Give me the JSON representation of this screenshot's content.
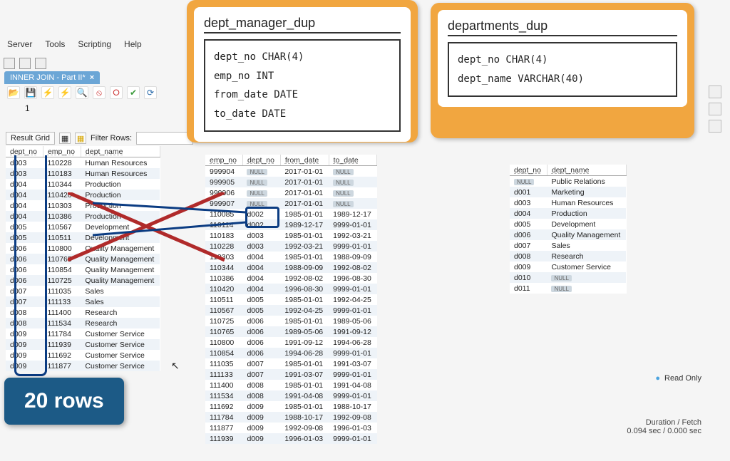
{
  "menu": {
    "server": "Server",
    "tools": "Tools",
    "scripting": "Scripting",
    "help": "Help"
  },
  "tab": {
    "label": "INNER JOIN - Part II*",
    "close": "×"
  },
  "row_indicator": "1",
  "result_bar": {
    "grid": "Result Grid",
    "filter": "Filter Rows:",
    "placeholder": ""
  },
  "card_left": {
    "title": "dept_manager_dup",
    "lines": [
      "dept_no CHAR(4)",
      "emp_no INT",
      "from_date DATE",
      "to_date DATE"
    ]
  },
  "card_right": {
    "title": "departments_dup",
    "lines": [
      "dept_no CHAR(4)",
      "dept_name VARCHAR(40)"
    ]
  },
  "join_table": {
    "headers": [
      "dept_no",
      "emp_no",
      "dept_name"
    ],
    "rows": [
      [
        "d003",
        "110228",
        "Human Resources"
      ],
      [
        "d003",
        "110183",
        "Human Resources"
      ],
      [
        "d004",
        "110344",
        "Production"
      ],
      [
        "d004",
        "110420",
        "Production"
      ],
      [
        "d004",
        "110303",
        "Production"
      ],
      [
        "d004",
        "110386",
        "Production"
      ],
      [
        "d005",
        "110567",
        "Development"
      ],
      [
        "d005",
        "110511",
        "Development"
      ],
      [
        "d006",
        "110800",
        "Quality Management"
      ],
      [
        "d006",
        "110765",
        "Quality Management"
      ],
      [
        "d006",
        "110854",
        "Quality Management"
      ],
      [
        "d006",
        "110725",
        "Quality Management"
      ],
      [
        "d007",
        "111035",
        "Sales"
      ],
      [
        "d007",
        "111133",
        "Sales"
      ],
      [
        "d008",
        "111400",
        "Research"
      ],
      [
        "d008",
        "111534",
        "Research"
      ],
      [
        "d009",
        "111784",
        "Customer Service"
      ],
      [
        "d009",
        "111939",
        "Customer Service"
      ],
      [
        "d009",
        "111692",
        "Customer Service"
      ],
      [
        "d009",
        "111877",
        "Customer Service"
      ]
    ]
  },
  "mid_table": {
    "headers": [
      "emp_no",
      "dept_no",
      "from_date",
      "to_date"
    ],
    "rows": [
      [
        "999904",
        "NULL",
        "2017-01-01",
        "NULL"
      ],
      [
        "999905",
        "NULL",
        "2017-01-01",
        "NULL"
      ],
      [
        "999906",
        "NULL",
        "2017-01-01",
        "NULL"
      ],
      [
        "999907",
        "NULL",
        "2017-01-01",
        "NULL"
      ],
      [
        "110085",
        "d002",
        "1985-01-01",
        "1989-12-17"
      ],
      [
        "110114",
        "d002",
        "1989-12-17",
        "9999-01-01"
      ],
      [
        "110183",
        "d003",
        "1985-01-01",
        "1992-03-21"
      ],
      [
        "110228",
        "d003",
        "1992-03-21",
        "9999-01-01"
      ],
      [
        "110303",
        "d004",
        "1985-01-01",
        "1988-09-09"
      ],
      [
        "110344",
        "d004",
        "1988-09-09",
        "1992-08-02"
      ],
      [
        "110386",
        "d004",
        "1992-08-02",
        "1996-08-30"
      ],
      [
        "110420",
        "d004",
        "1996-08-30",
        "9999-01-01"
      ],
      [
        "110511",
        "d005",
        "1985-01-01",
        "1992-04-25"
      ],
      [
        "110567",
        "d005",
        "1992-04-25",
        "9999-01-01"
      ],
      [
        "110725",
        "d006",
        "1985-01-01",
        "1989-05-06"
      ],
      [
        "110765",
        "d006",
        "1989-05-06",
        "1991-09-12"
      ],
      [
        "110800",
        "d006",
        "1991-09-12",
        "1994-06-28"
      ],
      [
        "110854",
        "d006",
        "1994-06-28",
        "9999-01-01"
      ],
      [
        "111035",
        "d007",
        "1985-01-01",
        "1991-03-07"
      ],
      [
        "111133",
        "d007",
        "1991-03-07",
        "9999-01-01"
      ],
      [
        "111400",
        "d008",
        "1985-01-01",
        "1991-04-08"
      ],
      [
        "111534",
        "d008",
        "1991-04-08",
        "9999-01-01"
      ],
      [
        "111692",
        "d009",
        "1985-01-01",
        "1988-10-17"
      ],
      [
        "111784",
        "d009",
        "1988-10-17",
        "1992-09-08"
      ],
      [
        "111877",
        "d009",
        "1992-09-08",
        "1996-01-03"
      ],
      [
        "111939",
        "d009",
        "1996-01-03",
        "9999-01-01"
      ]
    ]
  },
  "dept_table": {
    "headers": [
      "dept_no",
      "dept_name"
    ],
    "rows": [
      [
        "NULL",
        "Public Relations"
      ],
      [
        "d001",
        "Marketing"
      ],
      [
        "d003",
        "Human Resources"
      ],
      [
        "d004",
        "Production"
      ],
      [
        "d005",
        "Development"
      ],
      [
        "d006",
        "Quality Management"
      ],
      [
        "d007",
        "Sales"
      ],
      [
        "d008",
        "Research"
      ],
      [
        "d009",
        "Customer Service"
      ],
      [
        "d010",
        "NULL"
      ],
      [
        "d011",
        "NULL"
      ]
    ]
  },
  "rowcount": "20 rows",
  "readonly": "Read Only",
  "footer": {
    "label": "Duration / Fetch",
    "value": "0.094 sec / 0.000 sec"
  }
}
